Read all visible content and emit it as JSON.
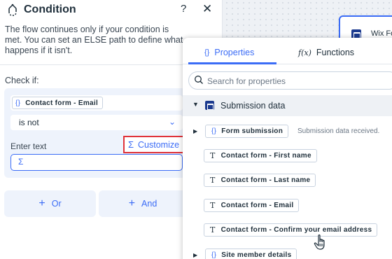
{
  "canvas": {
    "node_label": "Wix For"
  },
  "panel": {
    "title": "Condition",
    "help": "?",
    "close": "✕",
    "description": "The flow continues only if your condition is met. You can set an ELSE path to define what happens if it isn't.",
    "check_label": "Check if:",
    "field": {
      "braces": "{}",
      "label": "Contact form - Email"
    },
    "operator": {
      "value": "is not",
      "chevron": "⌄"
    },
    "enter_text_label": "Enter text",
    "customize": {
      "sigma": "Σ",
      "label": "Customize"
    },
    "text_input": {
      "sigma": "Σ",
      "value": ""
    },
    "or_button": {
      "plus": "+",
      "label": "Or"
    },
    "and_button": {
      "plus": "+",
      "label": "And"
    }
  },
  "popover": {
    "tabs": [
      {
        "icon": "{}",
        "label": "Properties",
        "active": true
      },
      {
        "icon": "f(x)",
        "label": "Functions",
        "active": false
      }
    ],
    "search": {
      "placeholder": "Search for properties"
    },
    "section": {
      "label": "Submission data",
      "expanded": true
    },
    "items": [
      {
        "type": "object",
        "icon": "{}",
        "label": "Form submission",
        "description": "Submission data received."
      },
      {
        "type": "text",
        "icon": "T",
        "label": "Contact form - First name"
      },
      {
        "type": "text",
        "icon": "T",
        "label": "Contact form - Last name"
      },
      {
        "type": "text",
        "icon": "T",
        "label": "Contact form - Email"
      },
      {
        "type": "text",
        "icon": "T",
        "label": "Contact form - Confirm your email address"
      },
      {
        "type": "object",
        "icon": "{}",
        "label": "Site member details"
      }
    ]
  },
  "colors": {
    "accent": "#3b6cf6",
    "highlight_border": "#e0333a",
    "panel_tint": "#eef3fc"
  }
}
